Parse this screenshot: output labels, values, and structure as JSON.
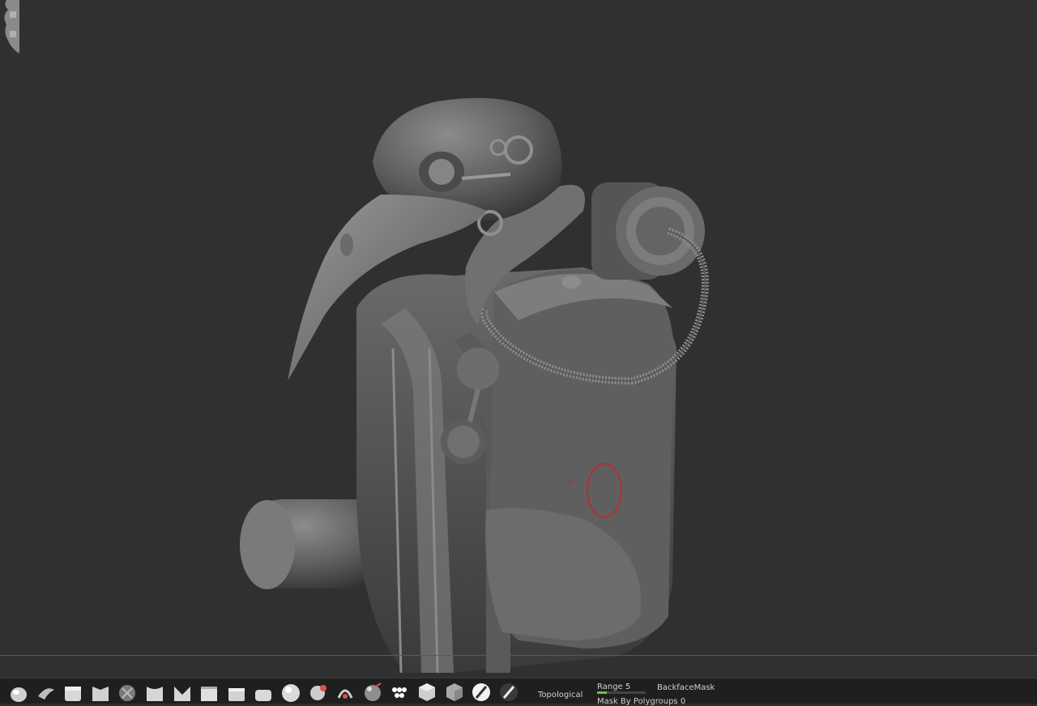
{
  "viewport": {
    "cursor_color": "#d02020"
  },
  "shelf": {
    "brushes": [
      {
        "id": "move",
        "icon": "move-brush-icon"
      },
      {
        "id": "snake-hook",
        "icon": "snakehook-brush-icon"
      },
      {
        "id": "clay-tubes",
        "icon": "claytubes-brush-icon"
      },
      {
        "id": "standard",
        "icon": "standard-brush-icon"
      },
      {
        "id": "ball",
        "icon": "ball-brush-icon"
      },
      {
        "id": "pinch",
        "icon": "pinch-brush-icon"
      },
      {
        "id": "dam-standard",
        "icon": "damstandard-brush-icon"
      },
      {
        "id": "trim",
        "icon": "trim-brush-icon"
      },
      {
        "id": "flatten",
        "icon": "flatten-brush-icon"
      },
      {
        "id": "polish",
        "icon": "polish-brush-icon"
      },
      {
        "id": "sphere",
        "icon": "sphere-brush-icon"
      },
      {
        "id": "inflate",
        "icon": "inflate-brush-icon"
      },
      {
        "id": "curve",
        "icon": "curve-brush-icon"
      },
      {
        "id": "insert",
        "icon": "insert-brush-icon"
      },
      {
        "id": "chain",
        "icon": "chain-brush-icon"
      },
      {
        "id": "cube",
        "icon": "cube-brush-icon"
      },
      {
        "id": "box",
        "icon": "box-brush-icon"
      },
      {
        "id": "pen",
        "icon": "pen-brush-icon"
      },
      {
        "id": "knife",
        "icon": "knife-brush-icon"
      }
    ],
    "topological_label": "Topological",
    "range_label": "Range 5",
    "range_value": 0.2,
    "backface_label": "BackfaceMask",
    "mask_polygroups_label": "Mask By Polygroups 0"
  },
  "colors": {
    "background": "#303030",
    "shelf": "#1f1f1f",
    "accent": "#6fbf3a"
  }
}
